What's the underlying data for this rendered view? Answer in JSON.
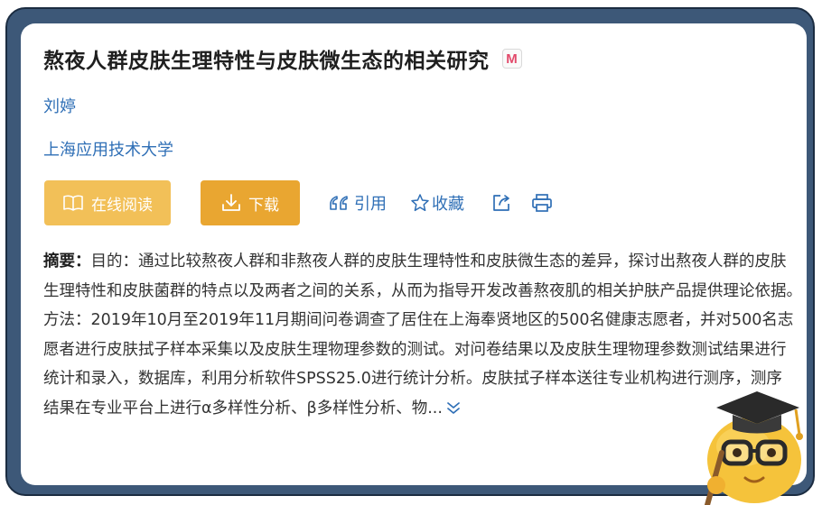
{
  "paper": {
    "title": "熬夜人群皮肤生理特性与皮肤微生态的相关研究",
    "badge": "M",
    "author": "刘婷",
    "organization": "上海应用技术大学"
  },
  "actions": {
    "read_online": "在线阅读",
    "download": "下载",
    "cite": "引用",
    "favorite": "收藏"
  },
  "abstract": {
    "label": "摘要：",
    "text": "目的：通过比较熬夜人群和非熬夜人群的皮肤生理特性和皮肤微生态的差异，探讨出熬夜人群的皮肤生理特性和皮肤菌群的特点以及两者之间的关系，从而为指导开发改善熬夜肌的相关护肤产品提供理论依据。　　方法：2019年10月至2019年11月期间问卷调查了居住在上海奉贤地区的500名健康志愿者，并对500名志愿者进行皮肤拭子样本采集以及皮肤生理物理参数的测试。对问卷结果以及皮肤生理物理参数测试结果进行统计和录入，数据库，利用分析软件SPSS25.0进行统计分析。皮肤拭子样本送往专业机构进行测序，测序结果在专业平台上进行α多样性分析、β多样性分析、物..."
  },
  "colors": {
    "frame": "#3d5878",
    "link": "#2f6fb6",
    "read_button": "#f2c058",
    "download_button": "#e9a631"
  }
}
